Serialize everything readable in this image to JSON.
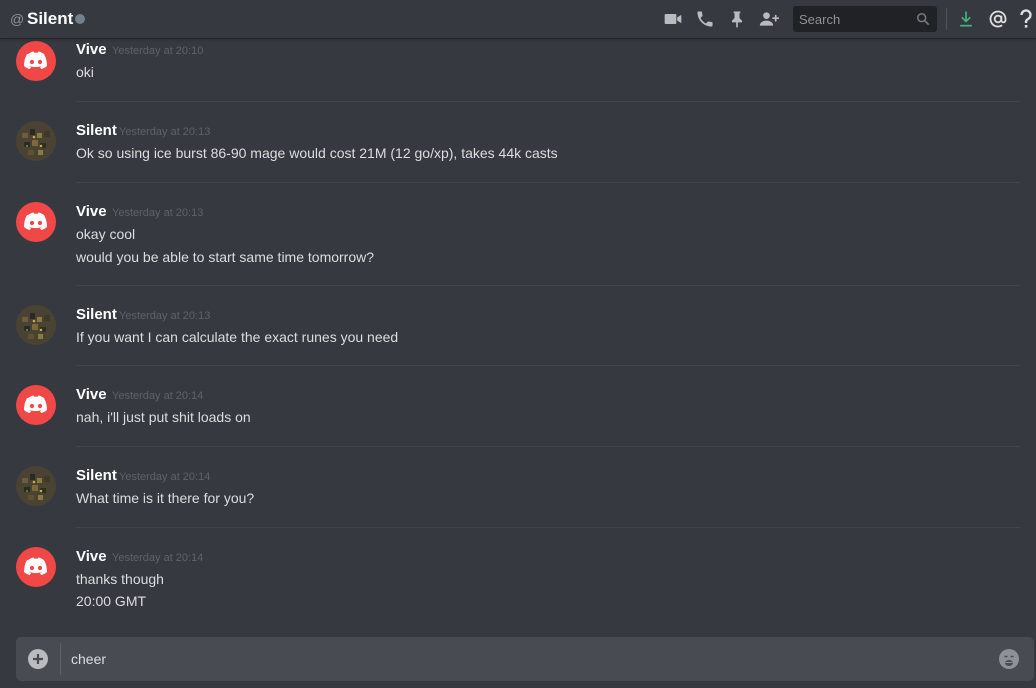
{
  "header": {
    "at_symbol": "@",
    "channel_name": "Silent",
    "status_color": "#747f8d",
    "icons": [
      "video-call-icon",
      "voice-call-icon",
      "pin-icon",
      "add-friend-icon",
      "download-icon",
      "mention-icon",
      "help-icon"
    ],
    "search_placeholder": "Search"
  },
  "messages": [
    {
      "author": "Vive",
      "timestamp": "Yesterday at 20:10",
      "lines": [
        "oki"
      ]
    },
    {
      "author": "Silent",
      "timestamp": "Yesterday at 20:13",
      "lines": [
        "Ok so using ice burst 86-90 mage would cost 21M (12 go/xp), takes 44k casts"
      ]
    },
    {
      "author": "Vive",
      "timestamp": "Yesterday at 20:13",
      "lines": [
        "okay cool",
        "would you be able to start same time tomorrow?"
      ]
    },
    {
      "author": "Silent",
      "timestamp": "Yesterday at 20:13",
      "lines": [
        "If you want I can calculate the exact runes you need"
      ]
    },
    {
      "author": "Vive",
      "timestamp": "Yesterday at 20:14",
      "lines": [
        "nah, i'll just put shit loads on"
      ]
    },
    {
      "author": "Silent",
      "timestamp": "Yesterday at 20:14",
      "lines": [
        "What time is it there for you?"
      ]
    },
    {
      "author": "Vive",
      "timestamp": "Yesterday at 20:14",
      "lines": [
        "thanks though",
        "20:00 GMT"
      ]
    }
  ],
  "composer": {
    "text": "cheer"
  },
  "colors": {
    "background": "#36393f",
    "vive_avatar": "#f04747",
    "download_accent": "#43b581"
  }
}
